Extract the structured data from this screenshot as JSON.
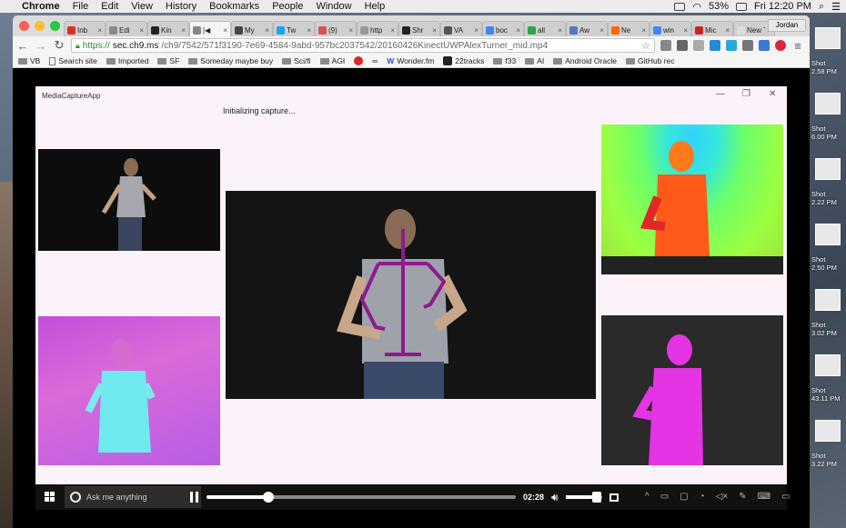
{
  "menubar": {
    "app": "Chrome",
    "items": [
      "File",
      "Edit",
      "View",
      "History",
      "Bookmarks",
      "People",
      "Window",
      "Help"
    ],
    "battery": "53%",
    "clock": "Fri 12:20 PM"
  },
  "tabs": [
    {
      "label": "Inb",
      "color": "#d93025"
    },
    {
      "label": "Edi",
      "color": "#888888"
    },
    {
      "label": "Kin",
      "color": "#222222"
    },
    {
      "label": "|◀",
      "color": "#888888",
      "active": true
    },
    {
      "label": "My",
      "color": "#444444"
    },
    {
      "label": "Tw",
      "color": "#1da1f2"
    },
    {
      "label": "(9)",
      "color": "#d9534f"
    },
    {
      "label": "http",
      "color": "#999999"
    },
    {
      "label": "Shr",
      "color": "#222222"
    },
    {
      "label": "VA",
      "color": "#555555"
    },
    {
      "label": "boc",
      "color": "#4285f4"
    },
    {
      "label": "all",
      "color": "#2aa84a"
    },
    {
      "label": "Aw",
      "color": "#5577bb"
    },
    {
      "label": "Ne",
      "color": "#ff6600"
    },
    {
      "label": "win",
      "color": "#4285f4"
    },
    {
      "label": "Mic",
      "color": "#cc2222"
    },
    {
      "label": "New T",
      "color": "#dddddd"
    }
  ],
  "profile": "Jordan",
  "address": {
    "scheme": "https://",
    "host": "sec.ch9.ms",
    "path": "/ch9/7542/571f3190-7e69-4584-9abd-957bc2037542/20160426KinectUWPAlexTurner_mid.mp4"
  },
  "bookmarks": [
    "VB",
    "Search site",
    "Imported",
    "SF",
    "Someday maybe buy",
    "Sci/fi",
    "AGI",
    "",
    "Wonder.fm",
    "22tracks",
    "f33",
    "AI",
    "Android Oracle",
    "GitHub rec"
  ],
  "app": {
    "title": "MediaCaptureApp",
    "status": "Initializing capture...",
    "minimize": "—",
    "restore": "❐",
    "close": "✕"
  },
  "taskbar": {
    "search_placeholder": "Ask me anything"
  },
  "player": {
    "time": "02:28",
    "progress": 0.2,
    "volume": 0.85
  },
  "desktop_shots": [
    {
      "line1": "Shot",
      "line2": "2.58 PM"
    },
    {
      "line1": "Shot",
      "line2": "6.00 PM"
    },
    {
      "line1": "Shot",
      "line2": "2.22 PM"
    },
    {
      "line1": "Shot",
      "line2": "2.50 PM"
    },
    {
      "line1": "Shot",
      "line2": "3.02 PM"
    },
    {
      "line1": "Shot",
      "line2": "43.11 PM"
    },
    {
      "line1": "Shot",
      "line2": "3.22 PM"
    }
  ]
}
